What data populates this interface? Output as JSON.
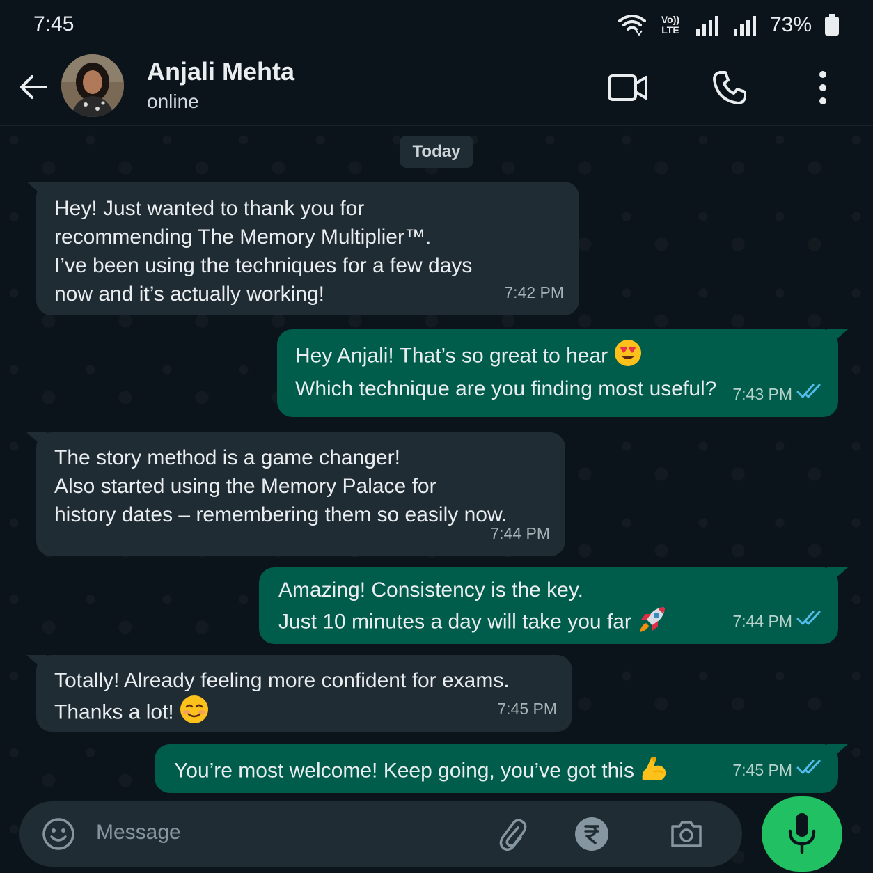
{
  "status_bar": {
    "time": "7:45",
    "network_label": "Vo)) LTE",
    "battery": "73%"
  },
  "header": {
    "contact_name": "Anjali Mehta",
    "contact_status": "online",
    "icons": [
      "back-arrow-icon",
      "avatar",
      "video-call-icon",
      "phone-icon",
      "more-options-icon"
    ]
  },
  "chat": {
    "date_chip": "Today",
    "messages": [
      {
        "direction": "in",
        "text": "Hey! Just wanted to thank you for\nrecommending The Memory Multiplier™.\nI’ve been using the techniques for a few days\nnow and it’s actually working!",
        "time": "7:42 PM"
      },
      {
        "direction": "out",
        "text": "Hey Anjali! That’s so great to hear",
        "text2": "Which technique are you finding most useful?",
        "emoji": "heart-eyes-emoji",
        "time": "7:43 PM",
        "read": true
      },
      {
        "direction": "in",
        "text": "The story method is a game changer!\nAlso started using the Memory Palace for\nhistory dates – remembering them so easily now.",
        "time": "7:44 PM"
      },
      {
        "direction": "out",
        "text": "Amazing! Consistency is the key.",
        "text2": "Just 10 minutes a day will take you far",
        "emoji": "rocket-emoji",
        "time": "7:44 PM",
        "read": true
      },
      {
        "direction": "in",
        "text": "Totally! Already feeling more confident for exams.",
        "text2": "Thanks a lot!",
        "emoji": "smiling-blush-emoji",
        "time": "7:45 PM"
      },
      {
        "direction": "out",
        "text": "You’re most welcome! Keep going, you’ve got this",
        "emoji": "flexed-biceps-emoji",
        "time": "7:45 PM",
        "read": true
      }
    ]
  },
  "composer": {
    "placeholder": "Message",
    "icons": [
      "emoji-icon",
      "attach-icon",
      "rupee-payment-icon",
      "camera-icon",
      "microphone-icon"
    ]
  },
  "colors": {
    "background": "#0b141a",
    "incoming_bubble": "#202c33",
    "outgoing_bubble": "#005c4b",
    "read_ticks": "#53bdeb",
    "mic_button": "#21c063"
  }
}
